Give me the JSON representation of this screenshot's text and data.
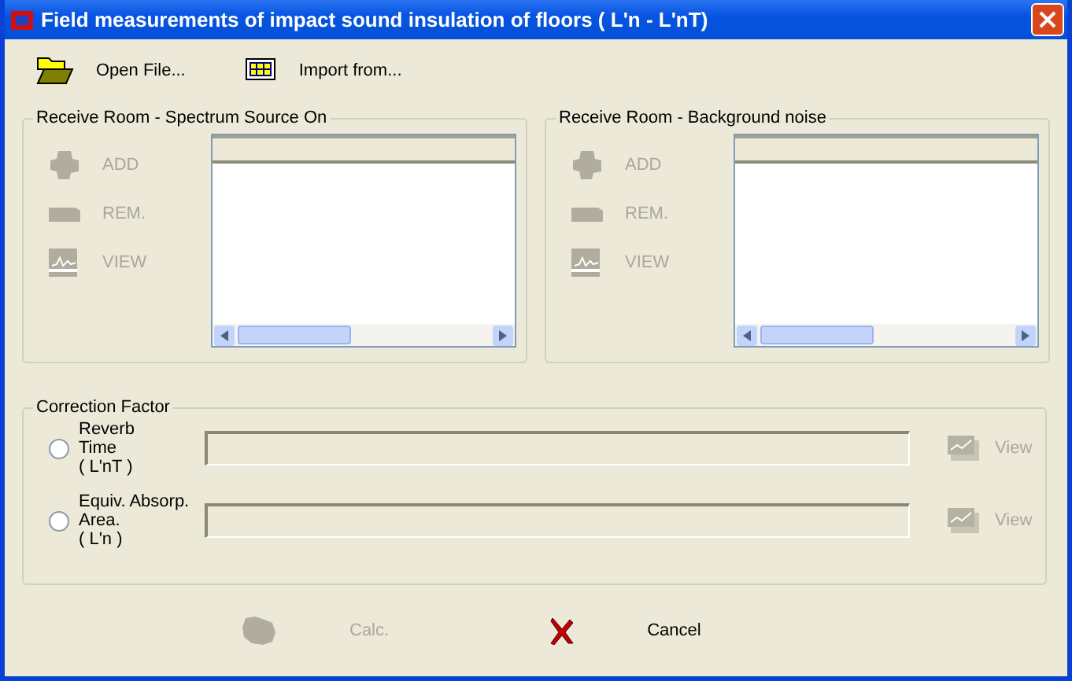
{
  "window": {
    "title": "Field measurements of impact sound insulation of floors ( L'n - L'nT)"
  },
  "toolbar": [
    {
      "label": "Open File...",
      "kind": "folder"
    },
    {
      "label": "Import from...",
      "kind": "table"
    }
  ],
  "groups": [
    {
      "title": "Receive Room - Spectrum Source On",
      "actions": [
        {
          "label": "ADD",
          "kind": "add",
          "disabled": true
        },
        {
          "label": "REM.",
          "kind": "remove",
          "disabled": true
        },
        {
          "label": "VIEW",
          "kind": "view",
          "disabled": true
        }
      ]
    },
    {
      "title": "Receive Room - Background noise",
      "actions": [
        {
          "label": "ADD",
          "kind": "add",
          "disabled": true
        },
        {
          "label": "REM.",
          "kind": "remove",
          "disabled": true
        },
        {
          "label": "VIEW",
          "kind": "view",
          "disabled": true
        }
      ]
    }
  ],
  "correction": {
    "title": "Correction Factor",
    "options": [
      {
        "label": "Reverb\nTime\n( L'nT )",
        "selected": false,
        "view": "View",
        "view_disabled": true
      },
      {
        "label": "Equiv. Absorp.\nArea.\n( L'n )",
        "selected": false,
        "view": "View",
        "view_disabled": true
      }
    ]
  },
  "buttons": [
    {
      "label": "Calc.",
      "kind": "calc",
      "disabled": true
    },
    {
      "label": "Cancel",
      "kind": "cancel",
      "disabled": false
    }
  ]
}
